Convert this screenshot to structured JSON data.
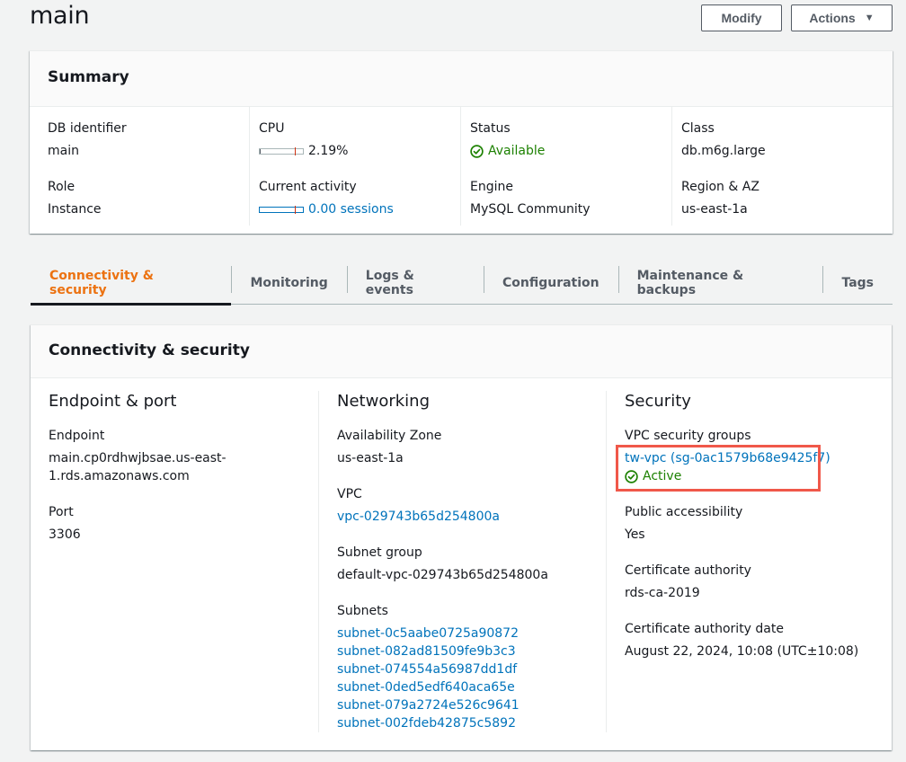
{
  "page": {
    "title": "main"
  },
  "toolbar": {
    "modify_label": "Modify",
    "actions_label": "Actions",
    "actions_caret": "▼"
  },
  "summary": {
    "title": "Summary",
    "db_identifier": {
      "label": "DB identifier",
      "value": "main"
    },
    "role": {
      "label": "Role",
      "value": "Instance"
    },
    "cpu": {
      "label": "CPU",
      "value": "2.19%",
      "percent": 2.19
    },
    "current_activity": {
      "label": "Current activity",
      "value": "0.00 sessions",
      "sessions": 0.0
    },
    "status": {
      "label": "Status",
      "value": "Available",
      "icon": "check-circle-icon"
    },
    "engine": {
      "label": "Engine",
      "value": "MySQL Community"
    },
    "class": {
      "label": "Class",
      "value": "db.m6g.large"
    },
    "region_az": {
      "label": "Region & AZ",
      "value": "us-east-1a"
    }
  },
  "tabs": [
    {
      "label": "Connectivity & security",
      "active": true
    },
    {
      "label": "Monitoring",
      "active": false
    },
    {
      "label": "Logs & events",
      "active": false
    },
    {
      "label": "Configuration",
      "active": false
    },
    {
      "label": "Maintenance & backups",
      "active": false
    },
    {
      "label": "Tags",
      "active": false
    }
  ],
  "connectivity": {
    "title": "Connectivity & security",
    "endpoint_port": {
      "title": "Endpoint & port",
      "endpoint": {
        "label": "Endpoint",
        "value_line1": "main.cp0rdhwjbsae.us-east-",
        "value_line2": "1.rds.amazonaws.com"
      },
      "port": {
        "label": "Port",
        "value": "3306"
      }
    },
    "networking": {
      "title": "Networking",
      "availability_zone": {
        "label": "Availability Zone",
        "value": "us-east-1a"
      },
      "vpc": {
        "label": "VPC",
        "value": "vpc-029743b65d254800a"
      },
      "subnet_group": {
        "label": "Subnet group",
        "value": "default-vpc-029743b65d254800a"
      },
      "subnets": {
        "label": "Subnets",
        "items": [
          "subnet-0c5aabe0725a90872",
          "subnet-082ad81509fe9b3c3",
          "subnet-074554a56987dd1df",
          "subnet-0ded5edf640aca65e",
          "subnet-079a2724e526c9641",
          "subnet-002fdeb42875c5892"
        ]
      }
    },
    "security": {
      "title": "Security",
      "vpc_security_groups": {
        "label": "VPC security groups",
        "value": "tw-vpc (sg-0ac1579b68e9425f7)",
        "status": "Active"
      },
      "public_accessibility": {
        "label": "Public accessibility",
        "value": "Yes"
      },
      "certificate_authority": {
        "label": "Certificate authority",
        "value": "rds-ca-2019"
      },
      "certificate_authority_date": {
        "label": "Certificate authority date",
        "value": "August 22, 2024, 10:08 (UTC±10:08)"
      }
    }
  },
  "colors": {
    "accent_active_tab": "#ec7211",
    "link": "#0073bb",
    "success": "#1d8102",
    "highlight": "#f0584a"
  }
}
